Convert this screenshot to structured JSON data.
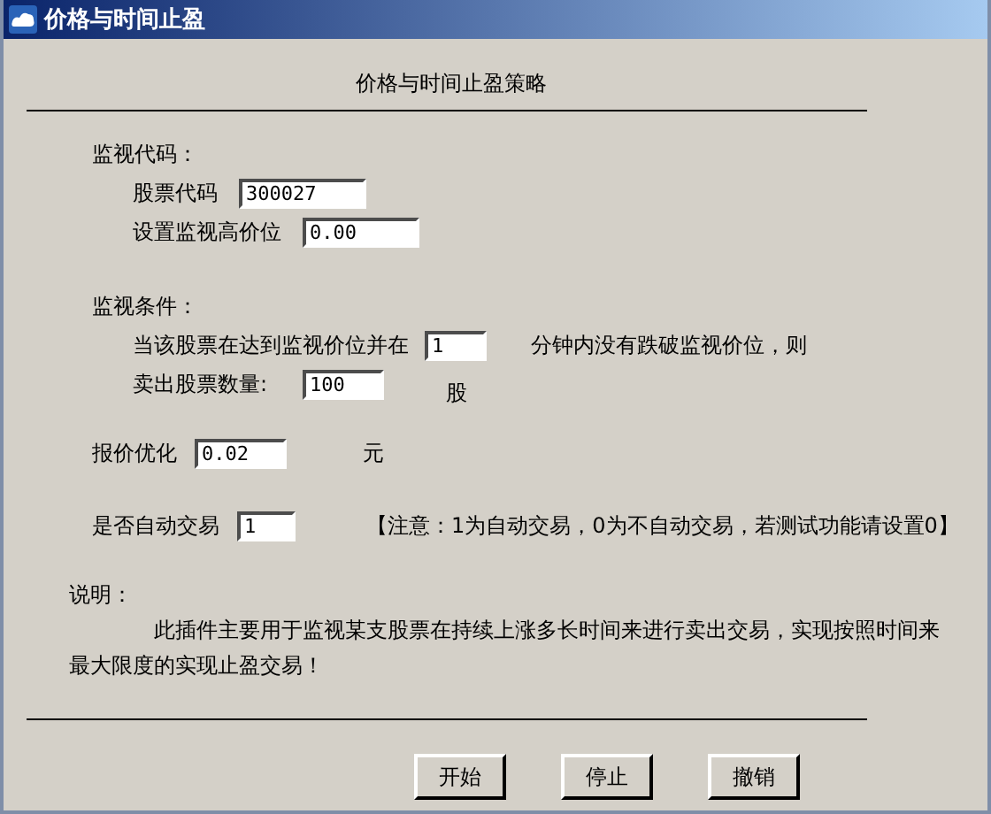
{
  "window": {
    "title": "价格与时间止盈"
  },
  "heading": "价格与时间止盈策略",
  "monitor_code": {
    "label": "监视代码：",
    "stock_code": {
      "label": "股票代码",
      "value": "300027"
    },
    "high_price": {
      "label": "设置监视高价位",
      "value": "0.00"
    }
  },
  "monitor_condition": {
    "label": "监视条件：",
    "condition_prefix": "当该股票在达到监视价位并在",
    "minutes": {
      "value": "1"
    },
    "condition_suffix": "分钟内没有跌破监视价位，则",
    "sell_label": "卖出股票数量:",
    "sell_quantity": {
      "value": "100"
    },
    "sell_unit": "股"
  },
  "price_optimization": {
    "label": "报价优化",
    "value": "0.02",
    "unit": "元"
  },
  "auto_trade": {
    "label": "是否自动交易",
    "value": "1",
    "note": "【注意：1为自动交易，0为不自动交易，若测试功能请设置0】"
  },
  "description": {
    "label": "说明：",
    "text": "此插件主要用于监视某支股票在持续上涨多长时间来进行卖出交易，实现按照时间来最大限度的实现止盈交易！"
  },
  "buttons": [
    "开始",
    "停止",
    "撤销"
  ]
}
